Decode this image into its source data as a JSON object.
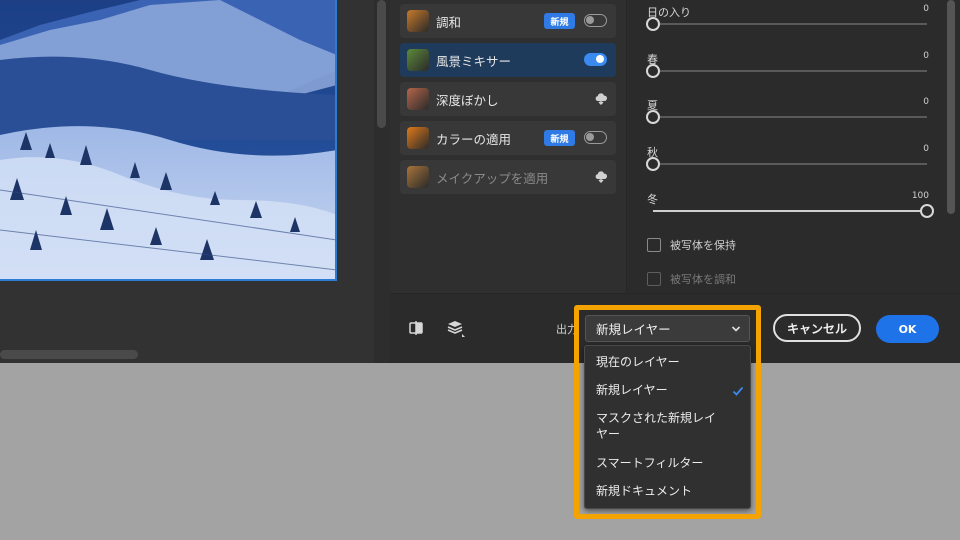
{
  "filters": [
    {
      "label": "調和",
      "badge": "新規",
      "control": "toggle",
      "toggle_on": false,
      "active": false,
      "disabled": false,
      "thumb_color": "#c87a2a"
    },
    {
      "label": "風景ミキサー",
      "badge": "",
      "control": "toggle",
      "toggle_on": true,
      "active": true,
      "disabled": false,
      "thumb_color": "#5c8a3a"
    },
    {
      "label": "深度ぼかし",
      "badge": "",
      "control": "cloud",
      "toggle_on": false,
      "active": false,
      "disabled": false,
      "thumb_color": "#b5664a"
    },
    {
      "label": "カラーの適用",
      "badge": "新規",
      "control": "toggle",
      "toggle_on": false,
      "active": false,
      "disabled": false,
      "thumb_color": "#e07a1a"
    },
    {
      "label": "メイクアップを適用",
      "badge": "",
      "control": "cloud",
      "toggle_on": false,
      "active": false,
      "disabled": true,
      "thumb_color": "#a8743a"
    }
  ],
  "sliders": [
    {
      "label": "日の入り",
      "value": "0",
      "fraction": 0
    },
    {
      "label": "春",
      "value": "0",
      "fraction": 0
    },
    {
      "label": "夏",
      "value": "0",
      "fraction": 0
    },
    {
      "label": "秋",
      "value": "0",
      "fraction": 0
    },
    {
      "label": "冬",
      "value": "100",
      "fraction": 1
    }
  ],
  "checkboxes": [
    {
      "label": "被写体を保持",
      "checked": false,
      "disabled": false
    },
    {
      "label": "被写体を調和",
      "checked": false,
      "disabled": true
    }
  ],
  "bottom": {
    "output_label": "出力",
    "output_value": "新規レイヤー",
    "cancel_label": "キャンセル",
    "ok_label": "OK"
  },
  "menu": {
    "items": [
      {
        "label": "現在のレイヤー",
        "selected": false
      },
      {
        "label": "新規レイヤー",
        "selected": true
      },
      {
        "label": "マスクされた新規レイ\nヤー",
        "selected": false
      },
      {
        "label": "スマートフィルター",
        "selected": false
      },
      {
        "label": "新規ドキュメント",
        "selected": false
      }
    ]
  },
  "icons": {
    "compare": "compare-icon",
    "layers": "layers-icon",
    "cloud": "cloud-download-icon",
    "chevron": "chevron-down-icon",
    "check": "checkmark-icon"
  },
  "colors": {
    "accent": "#1f73e8",
    "highlight": "#f5a300",
    "active_item": "#1f3b5c"
  }
}
